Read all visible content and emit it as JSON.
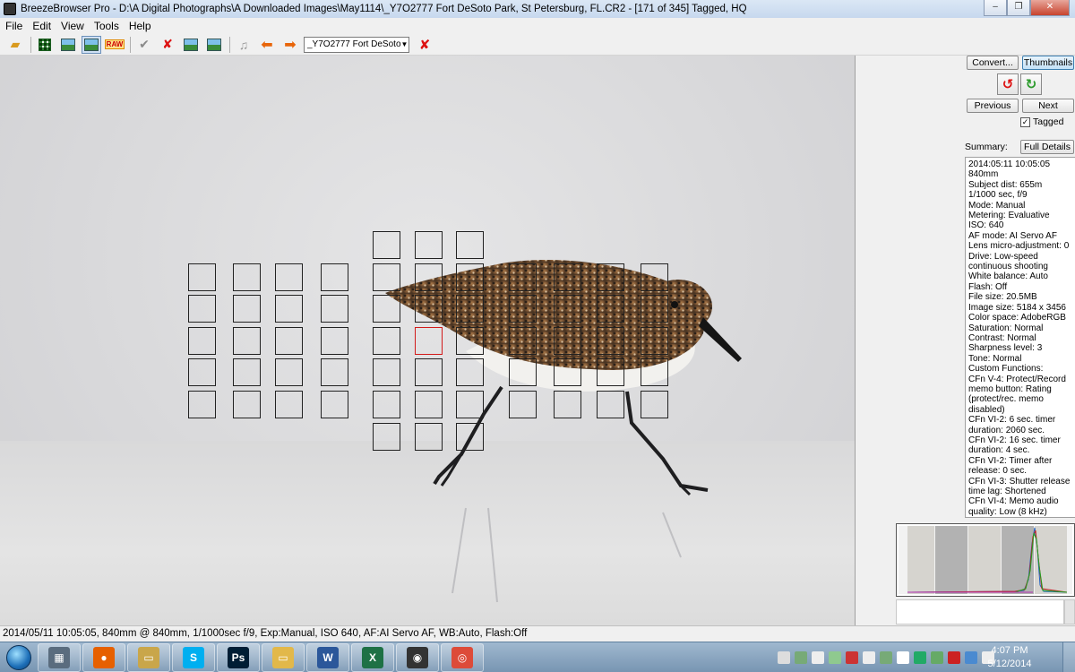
{
  "window": {
    "title": "BreezeBrowser Pro - D:\\A Digital Photographs\\A Downloaded Images\\May1114\\_Y7O2777  Fort DeSoto Park, St Petersburg, FL.CR2 - [171 of 345] Tagged, HQ",
    "minimize": "–",
    "maximize": "❐",
    "close": "✕"
  },
  "menu": [
    "File",
    "Edit",
    "View",
    "Tools",
    "Help"
  ],
  "toolbar": {
    "file_select": "_Y7O2777  Fort DeSoto",
    "raw_label": "RAW"
  },
  "panel": {
    "convert": "Convert...",
    "thumbnails": "Thumbnails",
    "previous": "Previous",
    "next": "Next",
    "tagged": "Tagged",
    "tagged_checked": true,
    "summary": "Summary:",
    "full_details": "Full Details",
    "details": [
      "2014:05:11 10:05:05",
      "840mm",
      "Subject dist: 655m",
      "1/1000 sec, f/9",
      "Mode: Manual",
      "Metering: Evaluative",
      "ISO: 640",
      "AF mode: AI Servo AF",
      "Lens micro-adjustment: 0",
      "Drive: Low-speed",
      "continuous shooting",
      "White balance: Auto",
      "Flash: Off",
      "File size: 20.5MB",
      "Image size: 5184 x 3456",
      "Color space: AdobeRGB",
      "Saturation: Normal",
      "Contrast: Normal",
      "Sharpness level: 3",
      "Tone: Normal",
      "Custom Functions:",
      "CFn V-4: Protect/Record",
      "memo button: Rating",
      "(protect/rec. memo",
      "disabled)",
      "CFn VI-2: 6 sec. timer",
      "duration: 2060 sec.",
      "CFn VI-2: 16 sec. timer",
      "duration: 4 sec.",
      "CFn VI-2: Timer after",
      "release: 0 sec.",
      "CFn VI-3: Shutter release",
      "time lag: Shortened",
      "CFn VI-4: Memo audio",
      "quality: Low (8 kHz)"
    ]
  },
  "status": "2014/05/11 10:05:05, 840mm @ 840mm, 1/1000sec f/9, Exp:Manual, ISO 640, AF:AI Servo AF, WB:Auto, Flash:Off",
  "taskbar": {
    "apps": [
      {
        "name": "calculator",
        "glyph": "▦",
        "color": "#5a6c7e"
      },
      {
        "name": "firefox",
        "glyph": "●",
        "color": "#e66000"
      },
      {
        "name": "explorer",
        "glyph": "▭",
        "color": "#c9a64a"
      },
      {
        "name": "skype",
        "glyph": "S",
        "color": "#00aff0"
      },
      {
        "name": "photoshop",
        "glyph": "Ps",
        "color": "#001d34"
      },
      {
        "name": "folder",
        "glyph": "▭",
        "color": "#e2b84a"
      },
      {
        "name": "word",
        "glyph": "W",
        "color": "#2b579a"
      },
      {
        "name": "excel",
        "glyph": "X",
        "color": "#1e7145"
      },
      {
        "name": "breezebrowser",
        "glyph": "◉",
        "color": "#333333"
      },
      {
        "name": "chrome",
        "glyph": "◎",
        "color": "#dd4b39"
      }
    ],
    "time": "4:07 PM",
    "date": "5/12/2014"
  }
}
